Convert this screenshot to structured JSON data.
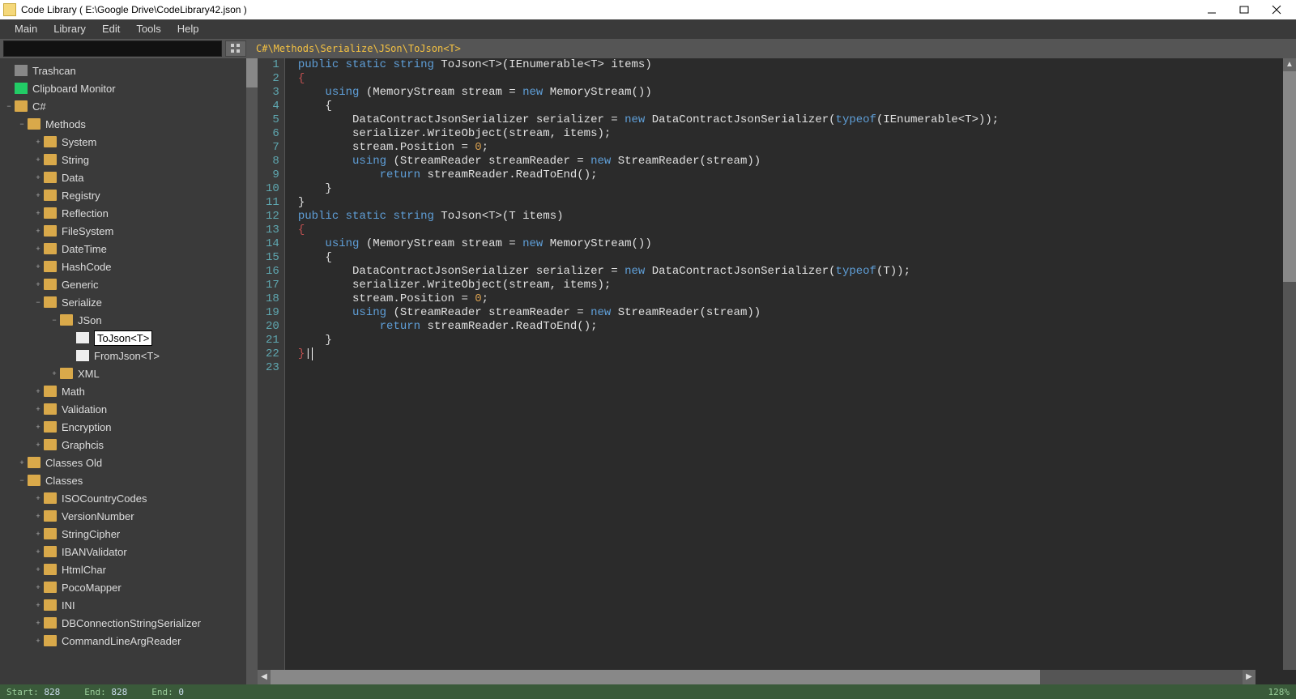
{
  "window": {
    "title": "Code Library ( E:\\Google Drive\\CodeLibrary42.json )"
  },
  "menu": [
    "Main",
    "Library",
    "Edit",
    "Tools",
    "Help"
  ],
  "breadcrumb": "C#\\Methods\\Serialize\\JSon\\ToJson<T>",
  "tree": [
    {
      "d": 0,
      "exp": "",
      "icon": "trash",
      "label": "Trashcan"
    },
    {
      "d": 0,
      "exp": "",
      "icon": "clip",
      "label": "Clipboard Monitor"
    },
    {
      "d": 0,
      "exp": "−",
      "icon": "folder",
      "label": "C#"
    },
    {
      "d": 1,
      "exp": "−",
      "icon": "folder",
      "label": "Methods"
    },
    {
      "d": 2,
      "exp": "+",
      "icon": "folder",
      "label": "System"
    },
    {
      "d": 2,
      "exp": "+",
      "icon": "folder",
      "label": "String"
    },
    {
      "d": 2,
      "exp": "+",
      "icon": "folder",
      "label": "Data"
    },
    {
      "d": 2,
      "exp": "+",
      "icon": "folder",
      "label": "Registry"
    },
    {
      "d": 2,
      "exp": "+",
      "icon": "folder",
      "label": "Reflection"
    },
    {
      "d": 2,
      "exp": "+",
      "icon": "folder",
      "label": "FileSystem"
    },
    {
      "d": 2,
      "exp": "+",
      "icon": "folder",
      "label": "DateTime"
    },
    {
      "d": 2,
      "exp": "+",
      "icon": "folder",
      "label": "HashCode"
    },
    {
      "d": 2,
      "exp": "+",
      "icon": "folder",
      "label": "Generic"
    },
    {
      "d": 2,
      "exp": "−",
      "icon": "folder",
      "label": "Serialize"
    },
    {
      "d": 3,
      "exp": "−",
      "icon": "folder",
      "label": "JSon"
    },
    {
      "d": 4,
      "exp": "",
      "icon": "file",
      "label": "ToJson<T>",
      "selected": true
    },
    {
      "d": 4,
      "exp": "",
      "icon": "file",
      "label": "FromJson<T>"
    },
    {
      "d": 3,
      "exp": "+",
      "icon": "folder",
      "label": "XML"
    },
    {
      "d": 2,
      "exp": "+",
      "icon": "folder",
      "label": "Math"
    },
    {
      "d": 2,
      "exp": "+",
      "icon": "folder",
      "label": "Validation"
    },
    {
      "d": 2,
      "exp": "+",
      "icon": "folder",
      "label": "Encryption"
    },
    {
      "d": 2,
      "exp": "+",
      "icon": "folder",
      "label": "Graphcis"
    },
    {
      "d": 1,
      "exp": "+",
      "icon": "folder",
      "label": "Classes Old"
    },
    {
      "d": 1,
      "exp": "−",
      "icon": "folder",
      "label": "Classes"
    },
    {
      "d": 2,
      "exp": "+",
      "icon": "folder",
      "label": "ISOCountryCodes"
    },
    {
      "d": 2,
      "exp": "+",
      "icon": "folder",
      "label": "VersionNumber"
    },
    {
      "d": 2,
      "exp": "+",
      "icon": "folder",
      "label": "StringCipher"
    },
    {
      "d": 2,
      "exp": "+",
      "icon": "folder",
      "label": "IBANValidator"
    },
    {
      "d": 2,
      "exp": "+",
      "icon": "folder",
      "label": "HtmlChar"
    },
    {
      "d": 2,
      "exp": "+",
      "icon": "folder",
      "label": "PocoMapper"
    },
    {
      "d": 2,
      "exp": "+",
      "icon": "folder",
      "label": "INI"
    },
    {
      "d": 2,
      "exp": "+",
      "icon": "folder",
      "label": "DBConnectionStringSerializer"
    },
    {
      "d": 2,
      "exp": "+",
      "icon": "folder",
      "label": "CommandLineArgReader"
    }
  ],
  "code_lines": [
    [
      {
        "t": "public",
        "c": "kw"
      },
      {
        "t": " "
      },
      {
        "t": "static",
        "c": "kw"
      },
      {
        "t": " "
      },
      {
        "t": "string",
        "c": "kw"
      },
      {
        "t": " ToJson<T>(IEnumerable<T> items)"
      }
    ],
    [
      {
        "t": "{",
        "c": "foldbrace"
      }
    ],
    [
      {
        "t": "    "
      },
      {
        "t": "using",
        "c": "kw"
      },
      {
        "t": " (MemoryStream stream = "
      },
      {
        "t": "new",
        "c": "kw"
      },
      {
        "t": " MemoryStream())"
      }
    ],
    [
      {
        "t": "    {"
      }
    ],
    [
      {
        "t": "        DataContractJsonSerializer serializer = "
      },
      {
        "t": "new",
        "c": "kw"
      },
      {
        "t": " DataContractJsonSerializer("
      },
      {
        "t": "typeof",
        "c": "kw"
      },
      {
        "t": "(IEnumerable<T>));"
      }
    ],
    [
      {
        "t": "        serializer.WriteObject(stream, items);"
      }
    ],
    [
      {
        "t": "        stream.Position = "
      },
      {
        "t": "0",
        "c": "num"
      },
      {
        "t": ";"
      }
    ],
    [
      {
        "t": "        "
      },
      {
        "t": "using",
        "c": "kw"
      },
      {
        "t": " (StreamReader streamReader = "
      },
      {
        "t": "new",
        "c": "kw"
      },
      {
        "t": " StreamReader(stream))"
      }
    ],
    [
      {
        "t": "            "
      },
      {
        "t": "return",
        "c": "kw"
      },
      {
        "t": " streamReader.ReadToEnd();"
      }
    ],
    [
      {
        "t": "    }"
      }
    ],
    [
      {
        "t": "}"
      }
    ],
    [
      {
        "t": ""
      }
    ],
    [
      {
        "t": "public",
        "c": "kw"
      },
      {
        "t": " "
      },
      {
        "t": "static",
        "c": "kw"
      },
      {
        "t": " "
      },
      {
        "t": "string",
        "c": "kw"
      },
      {
        "t": " ToJson<T>(T items)"
      }
    ],
    [
      {
        "t": "{",
        "c": "foldbrace"
      }
    ],
    [
      {
        "t": "    "
      },
      {
        "t": "using",
        "c": "kw"
      },
      {
        "t": " (MemoryStream stream = "
      },
      {
        "t": "new",
        "c": "kw"
      },
      {
        "t": " MemoryStream())"
      }
    ],
    [
      {
        "t": "    {"
      }
    ],
    [
      {
        "t": "        DataContractJsonSerializer serializer = "
      },
      {
        "t": "new",
        "c": "kw"
      },
      {
        "t": " DataContractJsonSerializer("
      },
      {
        "t": "typeof",
        "c": "kw"
      },
      {
        "t": "(T));"
      }
    ],
    [
      {
        "t": "        serializer.WriteObject(stream, items);"
      }
    ],
    [
      {
        "t": "        stream.Position = "
      },
      {
        "t": "0",
        "c": "num"
      },
      {
        "t": ";"
      }
    ],
    [
      {
        "t": "        "
      },
      {
        "t": "using",
        "c": "kw"
      },
      {
        "t": " (StreamReader streamReader = "
      },
      {
        "t": "new",
        "c": "kw"
      },
      {
        "t": " StreamReader(stream))"
      }
    ],
    [
      {
        "t": "            "
      },
      {
        "t": "return",
        "c": "kw"
      },
      {
        "t": " streamReader.ReadToEnd();"
      }
    ],
    [
      {
        "t": "    }"
      }
    ],
    [
      {
        "t": "}",
        "c": "foldbrace"
      },
      {
        "t": "|",
        "c": "cursor"
      }
    ]
  ],
  "status": {
    "start_lbl": "Start:",
    "start_val": "828",
    "end_lbl": "End:",
    "end_val": "828",
    "end2_lbl": "End:",
    "end2_val": "0",
    "zoom": "128%"
  }
}
